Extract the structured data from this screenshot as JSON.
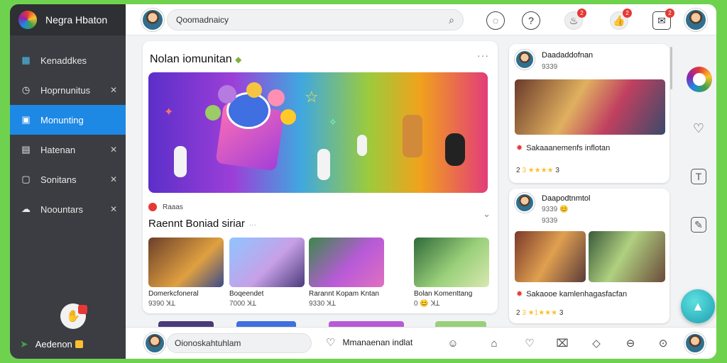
{
  "brand": {
    "name": "Negra Hbaton",
    "logo_icon": "app-logo-icon"
  },
  "sidebar": {
    "items": [
      {
        "label": "Kenaddkes",
        "icon": "image-icon",
        "closable": false
      },
      {
        "label": "Hoprnunitus",
        "icon": "clock-icon",
        "closable": true
      },
      {
        "label": "Monunting",
        "icon": "calendar-icon",
        "closable": false,
        "active": true
      },
      {
        "label": "Hatenan",
        "icon": "book-icon",
        "closable": true
      },
      {
        "label": "Sonitans",
        "icon": "square-icon",
        "closable": true
      },
      {
        "label": "Noountars",
        "icon": "cloud-icon",
        "closable": true
      }
    ],
    "user_name": "Aedenon"
  },
  "topbar": {
    "search_text": "Qoomadnaicy",
    "notifications": [
      "2",
      "2",
      "2"
    ]
  },
  "feed": {
    "title": "Nolan iomunitan",
    "poster": "Raaas",
    "section_title": "Raennt Boniad siriar",
    "thumbs": [
      {
        "caption": "Domerkcfoneral",
        "meta": "9390 ꓘꓕ"
      },
      {
        "caption": "Boqeendet",
        "meta": "7000 ꓘꓕ"
      },
      {
        "caption": "Rarannt Kopam Kntan",
        "meta": "9330 ꓘꓕ"
      },
      {
        "caption": "Bolan Komenttang",
        "meta": "0 😊 ꓘꓕ"
      }
    ]
  },
  "cards": [
    {
      "name": "Daadaddofnan",
      "meta": "9339",
      "title": "Sakaaanemenfs inflotan",
      "rating_prefix": "2",
      "stars": "3 ★★★★",
      "rating_suffix": "3"
    },
    {
      "name": "Daapodtnmtol",
      "meta": "9339 😊",
      "meta2": "9339",
      "title": "Sakaooe kamlenhagasfacfan",
      "rating_prefix": "2",
      "stars": "3 ★1★★★",
      "rating_suffix": "3"
    }
  ],
  "bottombar": {
    "comment_text": "Oionoskahtuhlam",
    "action_label": "Mmanaenan indlat"
  },
  "colors": {
    "page_bg": "#6fd24f",
    "sidebar_bg": "#3b3d42",
    "active": "#1e88e5",
    "badge": "#e53935"
  }
}
